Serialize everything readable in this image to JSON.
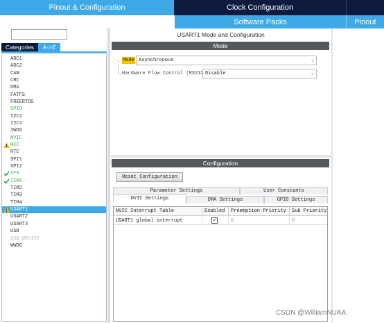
{
  "top_tabs": {
    "pinout": "Pinout & Configuration",
    "clock": "Clock Configuration"
  },
  "secondary": {
    "software_packs": "Software Packs",
    "pinout": "Pinout"
  },
  "left": {
    "search_value": "",
    "categories_tab": "Categories",
    "az_tab": "A->Z",
    "items": [
      {
        "label": "ADC1",
        "color": "#333333",
        "mark": ""
      },
      {
        "label": "ADC2",
        "color": "#333333",
        "mark": ""
      },
      {
        "label": "CAN",
        "color": "#333333",
        "mark": ""
      },
      {
        "label": "CRC",
        "color": "#333333",
        "mark": ""
      },
      {
        "label": "DMA",
        "color": "#333333",
        "mark": ""
      },
      {
        "label": "FATFS",
        "color": "#333333",
        "mark": ""
      },
      {
        "label": "FREERTOS",
        "color": "#333333",
        "mark": ""
      },
      {
        "label": "GPIO",
        "color": "#3aa64a",
        "mark": ""
      },
      {
        "label": "I2C1",
        "color": "#333333",
        "mark": ""
      },
      {
        "label": "I2C2",
        "color": "#333333",
        "mark": ""
      },
      {
        "label": "IWDG",
        "color": "#333333",
        "mark": ""
      },
      {
        "label": "NVIC",
        "color": "#3aa64a",
        "mark": ""
      },
      {
        "label": "RCC",
        "color": "#3aa64a",
        "mark": "warning"
      },
      {
        "label": "RTC",
        "color": "#333333",
        "mark": ""
      },
      {
        "label": "SPI1",
        "color": "#333333",
        "mark": ""
      },
      {
        "label": "SPI2",
        "color": "#333333",
        "mark": ""
      },
      {
        "label": "SYS",
        "color": "#3aa64a",
        "mark": "check"
      },
      {
        "label": "TIM1",
        "color": "#3aa64a",
        "mark": "check"
      },
      {
        "label": "TIM2",
        "color": "#333333",
        "mark": ""
      },
      {
        "label": "TIM3",
        "color": "#333333",
        "mark": ""
      },
      {
        "label": "TIM4",
        "color": "#333333",
        "mark": ""
      },
      {
        "label": "USART1",
        "color": "#ffffff",
        "mark": "warning",
        "selected": true
      },
      {
        "label": "USART2",
        "color": "#333333",
        "mark": ""
      },
      {
        "label": "USART3",
        "color": "#333333",
        "mark": ""
      },
      {
        "label": "USB",
        "color": "#333333",
        "mark": ""
      },
      {
        "label": "USB_DEVICE",
        "color": "#b5b5b5",
        "mark": "",
        "italic": true
      },
      {
        "label": "WWDG",
        "color": "#333333",
        "mark": ""
      }
    ]
  },
  "mode_panel": {
    "title": "USART1 Mode and Configuration",
    "section": "Mode",
    "mode_label": "Mode",
    "mode_value": "Asynchronous",
    "flow_label": "Hardware Flow Control (RS232)",
    "flow_value": "Disable"
  },
  "config_panel": {
    "section": "Configuration",
    "reset_button": "Reset Configuration",
    "tabs_row1": [
      "Parameter Settings",
      "User Constants"
    ],
    "tabs_row2": [
      "NVIC Settings",
      "DMA Settings",
      "GPIO Settings"
    ],
    "table": {
      "headers": [
        "NVIC Interrupt Table",
        "Enabled",
        "Preemption Priority",
        "Sub Priority"
      ],
      "rows": [
        {
          "name": "USART1 global interrupt",
          "enabled": true,
          "preemption": "0",
          "sub": "0"
        }
      ]
    }
  },
  "watermark": "CSDN @WilliamNUAA",
  "colors": {
    "accent": "#3da9e6",
    "dark_navy": "#0b1a3d",
    "section_dark": "#56595c",
    "warning": "#f2c200",
    "check": "#3aa64a"
  }
}
